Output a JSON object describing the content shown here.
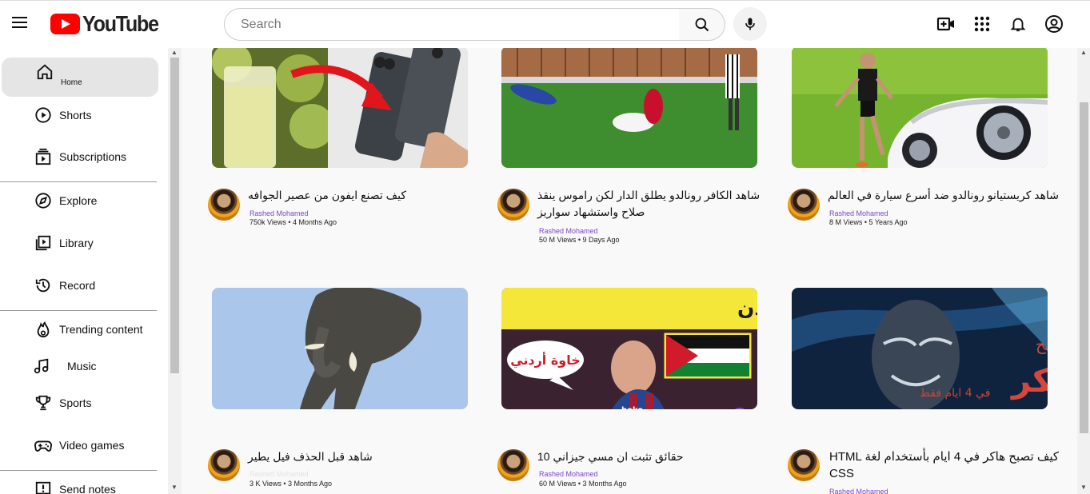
{
  "header": {
    "logo_text": "YouTube",
    "search_placeholder": "Search"
  },
  "sidebar": {
    "items": [
      {
        "label": "Home",
        "icon": "home-icon"
      },
      {
        "label": "Shorts",
        "icon": "shorts-icon"
      },
      {
        "label": "Subscriptions",
        "icon": "subscriptions-icon"
      },
      {
        "label": "Explore",
        "icon": "compass-icon"
      },
      {
        "label": "Library",
        "icon": "library-icon"
      },
      {
        "label": "Record",
        "icon": "history-icon"
      },
      {
        "label": "Trending content",
        "icon": "fire-icon"
      },
      {
        "label": "Music",
        "icon": "music-icon"
      },
      {
        "label": "Sports",
        "icon": "trophy-icon"
      },
      {
        "label": "Video games",
        "icon": "gamepad-icon"
      },
      {
        "label": "Send notes",
        "icon": "feedback-icon"
      }
    ]
  },
  "videos": [
    {
      "title": "كيف تصنع ايفون من عصير الجوافه",
      "channel": "Rashed Mohamed",
      "meta": "750k Views • 4 Months Ago"
    },
    {
      "title": "شاهد الكافر رونالدو يطلق الدار لكن راموس ينقذ صلاح واستشهاد سواريز",
      "channel": "Rashed Mohamed",
      "meta": "50 M Views • 9 Days Ago"
    },
    {
      "title": "شاهد كريستيانو رونالدو ضد أسرع سيارة في العالم",
      "channel": "Rashed Mohamed",
      "meta": "8 M Views • 5 Years Ago"
    },
    {
      "title": "شاهد قبل الحذف فيل يطير",
      "channel": "Rashed Mohamed",
      "meta": "3 K Views • 3 Months Ago"
    },
    {
      "title": "حقائق تثبت ان مسي جيزاني 10",
      "channel": "Rashed Mohamed",
      "meta": "60 M Views • 3 Months Ago"
    },
    {
      "title": "كيف تصبح هاكر في 4 ايام بأستخدام لغة HTML CSS",
      "channel": "Rashed Mohamed",
      "meta": ""
    }
  ],
  "thumbnail_text": {
    "messi_banner": "اثبات أن ميسي من الأردن",
    "messi_bubble": "خاوة أردني",
    "hacker_line1": "كيفه تصبح",
    "hacker_line2": "هكر",
    "hacker_line3": "في 4 ايام فقط"
  },
  "colors": {
    "brand_red": "#ff0000",
    "channel_purple": "#7b45c8",
    "active_item_bg": "#e5e5e5"
  }
}
